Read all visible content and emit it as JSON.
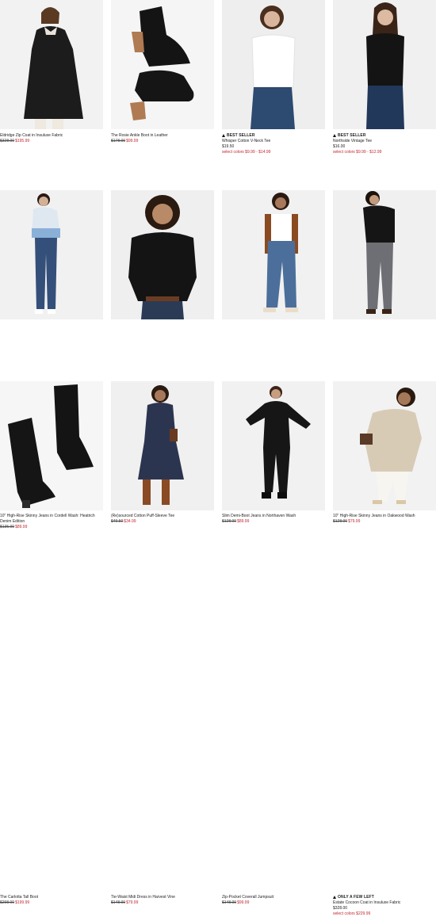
{
  "products": [
    {
      "name": "Eldridge Zip Coat in Insuluxe Fabric",
      "badge": "",
      "price": "",
      "original_price": "$328.00",
      "sale_price": "$195.99",
      "colors_note": "",
      "image_icon": "wool-coat-photo"
    },
    {
      "name": "The Rosie Ankle Boot in Leather",
      "badge": "",
      "price": "",
      "original_price": "$178.00",
      "sale_price": "$99.99",
      "colors_note": "",
      "image_icon": "ankle-boot-photo"
    },
    {
      "name": "Whisper Cotton V-Neck Tee",
      "badge": "BEST SELLER",
      "price": "$19.50",
      "original_price": "",
      "sale_price": "",
      "colors_note": "select colors $9.99 - $14.99",
      "image_icon": "white-tee-photo"
    },
    {
      "name": "Northside Vintage Tee",
      "badge": "BEST SELLER",
      "price": "$16.00",
      "original_price": "",
      "sale_price": "",
      "colors_note": "select colors $9.99 - $12.99",
      "image_icon": "black-tee-photo"
    },
    {
      "name": "10\" High-Rise Skinny Jeans in Cordell Wash: Heatrich Denim Edition",
      "badge": "",
      "price": "",
      "original_price": "$135.00",
      "sale_price": "$89.99",
      "colors_note": "",
      "image_icon": "skinny-jeans-photo"
    },
    {
      "name": "(Re)sourced Cotton Puff-Sleeve Tee",
      "badge": "",
      "price": "",
      "original_price": "$49.50",
      "sale_price": "$34.99",
      "colors_note": "",
      "image_icon": "puff-sleeve-tee-photo"
    },
    {
      "name": "Slim Demi-Boot Jeans in Northaven Wash",
      "badge": "",
      "price": "",
      "original_price": "$128.00",
      "sale_price": "$89.99",
      "colors_note": "",
      "image_icon": "demi-boot-jeans-photo"
    },
    {
      "name": "10\" High-Rise Skinny Jeans in Oakwood Wash",
      "badge": "",
      "price": "",
      "original_price": "$128.00",
      "sale_price": "$79.99",
      "colors_note": "",
      "image_icon": "grey-skinny-jeans-photo"
    },
    {
      "name": "The Carlotta Tall Boot",
      "badge": "",
      "price": "",
      "original_price": "$298.00",
      "sale_price": "$199.99",
      "colors_note": "",
      "image_icon": "tall-boot-photo"
    },
    {
      "name": "Tie-Waist Midi Dress in Harvest Vine",
      "badge": "",
      "price": "",
      "original_price": "$148.00",
      "sale_price": "$79.99",
      "colors_note": "",
      "image_icon": "midi-dress-photo"
    },
    {
      "name": "Zip-Pocket Coverall Jumpsuit",
      "badge": "",
      "price": "",
      "original_price": "$148.00",
      "sale_price": "$99.99",
      "colors_note": "",
      "image_icon": "jumpsuit-photo"
    },
    {
      "name": "Estate Cocoon Coat in Insuluxe Fabric",
      "badge": "ONLY A FEW LEFT",
      "price": "$328.00",
      "original_price": "",
      "sale_price": "",
      "colors_note": "select colors $229.99",
      "image_icon": "cocoon-coat-photo"
    }
  ],
  "colors": {
    "sale": "#c0262d",
    "text": "#222222",
    "image_bg": "#f3f3f3"
  }
}
